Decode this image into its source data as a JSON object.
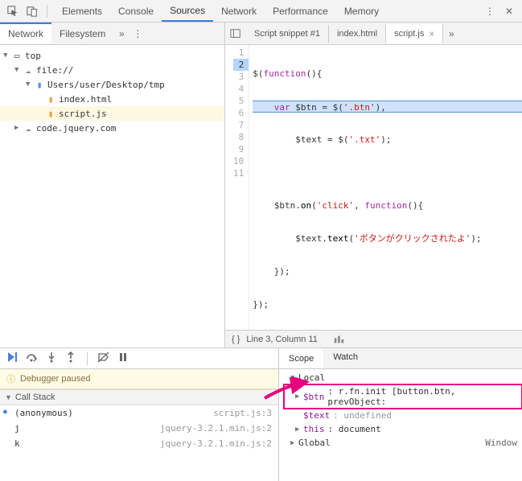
{
  "topbar": {
    "tabs": [
      "Elements",
      "Console",
      "Sources",
      "Network",
      "Performance",
      "Memory"
    ],
    "active": "Sources"
  },
  "leftTabs": {
    "items": [
      "Network",
      "Filesystem"
    ],
    "active": "Network"
  },
  "tree": {
    "top": "top",
    "file": "file://",
    "path": "Users/user/Desktop/tmp",
    "files": [
      "index.html",
      "script.js"
    ],
    "selected": "script.js",
    "cdn": "code.jquery.com"
  },
  "fileTabs": {
    "items": [
      "Script snippet #1",
      "index.html",
      "script.js"
    ],
    "active": "script.js"
  },
  "editor": {
    "lines": [
      "1",
      "2",
      "3",
      "4",
      "5",
      "6",
      "7",
      "8",
      "9",
      "10",
      "11"
    ],
    "highlightLine": "2",
    "code": {
      "l1a": "$(",
      "l1b": "function",
      "l1c": "(){",
      "l2a": "    ",
      "l2b": "var",
      "l2c": " $btn = $(",
      "l2d": "'.btn'",
      "l2e": "),",
      "l3a": "        $text = $(",
      "l3b": "'.txt'",
      "l3c": ");",
      "l4": "",
      "l5a": "    $btn.",
      "l5b": "on",
      "l5c": "(",
      "l5d": "'click'",
      "l5e": ", ",
      "l5f": "function",
      "l5g": "(){",
      "l6a": "        $text.",
      "l6b": "text",
      "l6c": "(",
      "l6d": "'ボタンがクリックされたよ'",
      "l6e": ");",
      "l7": "    });",
      "l8": "});"
    }
  },
  "status": {
    "cursor": "Line 3, Column 11"
  },
  "debugger": {
    "pausedMsg": "Debugger paused"
  },
  "callstack": {
    "title": "Call Stack",
    "rows": [
      {
        "name": "(anonymous)",
        "loc": "script.js:3"
      },
      {
        "name": "j",
        "loc": "jquery-3.2.1.min.js:2"
      },
      {
        "name": "k",
        "loc": "jquery-3.2.1.min.js:2"
      }
    ]
  },
  "scopeTabs": {
    "items": [
      "Scope",
      "Watch"
    ],
    "active": "Scope"
  },
  "scope": {
    "local": "Local",
    "btnName": "$btn",
    "btnVal": ": r.fn.init [button.btn, prevObject:",
    "textName": "$text",
    "textVal": ": undefined",
    "thisName": "this",
    "thisVal": ": document",
    "global": "Global",
    "globalVal": "Window"
  }
}
